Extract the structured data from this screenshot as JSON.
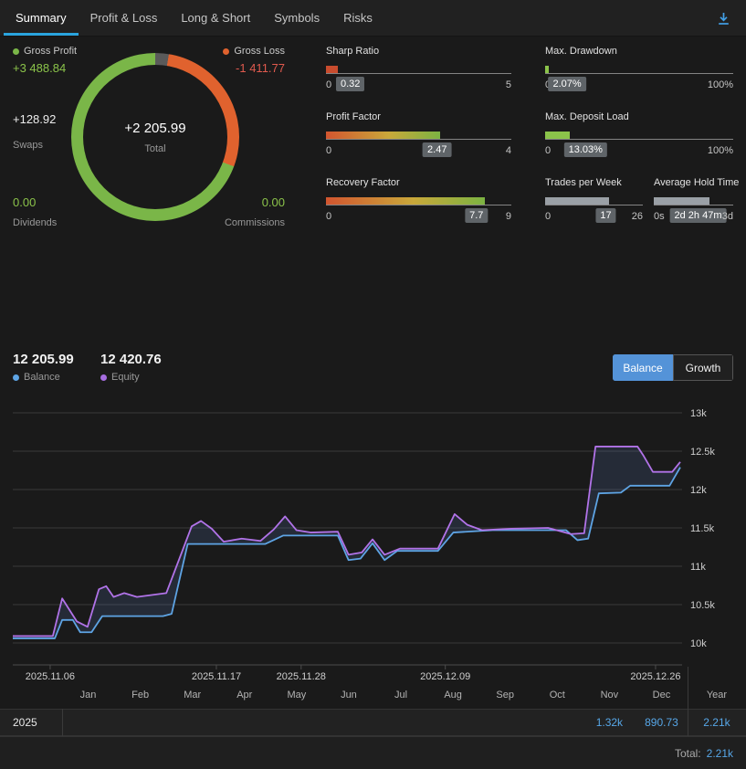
{
  "colors": {
    "accent_blue": "#2aa4de",
    "green": "#8bc34a",
    "orange": "#e0622e",
    "loss_red": "#e05a4e",
    "balance_line": "#5ea4e4",
    "equity_line": "#b173e8",
    "table_value_blue": "#57a7e8",
    "toggle_active": "#5493d8"
  },
  "tab_bar": {
    "tabs": [
      {
        "label": "Summary",
        "active": true
      },
      {
        "label": "Profit & Loss",
        "active": false
      },
      {
        "label": "Long & Short",
        "active": false
      },
      {
        "label": "Symbols",
        "active": false
      },
      {
        "label": "Risks",
        "active": false
      }
    ]
  },
  "summary": {
    "gross_profit": {
      "label": "Gross Profit",
      "value": "+3 488.84"
    },
    "gross_loss": {
      "label": "Gross Loss",
      "value": "-1 411.77"
    },
    "donut": {
      "center_value": "+2 205.99",
      "center_label": "Total",
      "segments": [
        {
          "name": "swaps",
          "color": "#5a5a5a",
          "pct": 2.6
        },
        {
          "name": "gross-loss",
          "color": "#e0622e",
          "pct": 28.1
        },
        {
          "name": "gross-profit",
          "color": "#7ab648",
          "pct": 69.3
        }
      ]
    },
    "swaps": {
      "value": "+128.92",
      "label": "Swaps"
    },
    "dividends": {
      "value": "0.00",
      "label": "Dividends"
    },
    "commissions": {
      "value": "0.00",
      "label": "Commissions"
    }
  },
  "gauges": [
    {
      "id": "sharp-ratio",
      "label": "Sharp Ratio",
      "min": "0",
      "max": "5",
      "value": "0.32",
      "fill_pct": 6.4,
      "style": "red"
    },
    {
      "id": "max-drawdown",
      "label": "Max. Drawdown",
      "min": "0",
      "max": "100%",
      "value": "2.07%",
      "fill_pct": 2.1,
      "style": "green"
    },
    {
      "id": "profit-factor",
      "label": "Profit Factor",
      "min": "0",
      "max": "4",
      "value": "2.47",
      "fill_pct": 61.8,
      "style": "gradient"
    },
    {
      "id": "max-deposit-load",
      "label": "Max. Deposit Load",
      "min": "0",
      "max": "100%",
      "value": "13.03%",
      "fill_pct": 13.0,
      "style": "green"
    },
    {
      "id": "recovery-factor",
      "label": "Recovery Factor",
      "min": "0",
      "max": "9",
      "value": "7.7",
      "fill_pct": 85.6,
      "style": "gradient"
    },
    {
      "id": "trades-per-week",
      "label": "Trades per Week",
      "min": "0",
      "max": "26",
      "value": "17",
      "fill_pct": 65.4,
      "style": "gray"
    },
    {
      "id": "average-hold-time",
      "label": "Average Hold Time",
      "min": "0s",
      "max": "3d",
      "value": "2d 2h 47m",
      "fill_pct": 70.0,
      "style": "gray"
    }
  ],
  "balance_header": {
    "balance_value": "12 205.99",
    "balance_label": "Balance",
    "equity_value": "12 420.76",
    "equity_label": "Equity",
    "toggle": [
      {
        "label": "Balance",
        "active": true
      },
      {
        "label": "Growth",
        "active": false
      }
    ]
  },
  "chart_data": {
    "type": "line",
    "ylim": [
      10000,
      13000
    ],
    "grid": true,
    "legend_position": "top-left",
    "y_ticks": [
      {
        "v": 13000,
        "label": "13k"
      },
      {
        "v": 12500,
        "label": "12.5k"
      },
      {
        "v": 12000,
        "label": "12k"
      },
      {
        "v": 11500,
        "label": "11.5k"
      },
      {
        "v": 11000,
        "label": "11k"
      },
      {
        "v": 10500,
        "label": "10.5k"
      },
      {
        "v": 10000,
        "label": "10k"
      }
    ],
    "x_ticks": [
      {
        "f": 0.056,
        "label": "2025.11.06"
      },
      {
        "f": 0.305,
        "label": "2025.11.17"
      },
      {
        "f": 0.432,
        "label": "2025.11.28"
      },
      {
        "f": 0.648,
        "label": "2025.12.09"
      },
      {
        "f": 0.963,
        "label": "2025.12.26"
      }
    ],
    "series": [
      {
        "name": "Balance",
        "color": "#5ea4e4",
        "points": [
          [
            0,
            10060
          ],
          [
            0.063,
            10060
          ],
          [
            0.074,
            10300
          ],
          [
            0.09,
            10300
          ],
          [
            0.101,
            10140
          ],
          [
            0.118,
            10140
          ],
          [
            0.134,
            10350
          ],
          [
            0.225,
            10350
          ],
          [
            0.238,
            10380
          ],
          [
            0.262,
            11290
          ],
          [
            0.378,
            11290
          ],
          [
            0.405,
            11400
          ],
          [
            0.487,
            11400
          ],
          [
            0.503,
            11080
          ],
          [
            0.521,
            11100
          ],
          [
            0.539,
            11300
          ],
          [
            0.557,
            11080
          ],
          [
            0.576,
            11200
          ],
          [
            0.637,
            11200
          ],
          [
            0.66,
            11440
          ],
          [
            0.719,
            11470
          ],
          [
            0.829,
            11470
          ],
          [
            0.846,
            11340
          ],
          [
            0.862,
            11360
          ],
          [
            0.878,
            11950
          ],
          [
            0.911,
            11960
          ],
          [
            0.925,
            12050
          ],
          [
            0.984,
            12050
          ],
          [
            1,
            12290
          ]
        ]
      },
      {
        "name": "Equity",
        "color": "#b173e8",
        "points": [
          [
            0,
            10090
          ],
          [
            0.06,
            10090
          ],
          [
            0.074,
            10580
          ],
          [
            0.085,
            10430
          ],
          [
            0.096,
            10280
          ],
          [
            0.112,
            10210
          ],
          [
            0.129,
            10700
          ],
          [
            0.14,
            10740
          ],
          [
            0.151,
            10600
          ],
          [
            0.167,
            10650
          ],
          [
            0.186,
            10600
          ],
          [
            0.23,
            10650
          ],
          [
            0.268,
            11520
          ],
          [
            0.282,
            11590
          ],
          [
            0.298,
            11490
          ],
          [
            0.316,
            11320
          ],
          [
            0.343,
            11360
          ],
          [
            0.371,
            11330
          ],
          [
            0.391,
            11480
          ],
          [
            0.408,
            11650
          ],
          [
            0.425,
            11470
          ],
          [
            0.446,
            11440
          ],
          [
            0.487,
            11450
          ],
          [
            0.503,
            11150
          ],
          [
            0.523,
            11180
          ],
          [
            0.539,
            11350
          ],
          [
            0.557,
            11150
          ],
          [
            0.58,
            11230
          ],
          [
            0.637,
            11230
          ],
          [
            0.662,
            11680
          ],
          [
            0.681,
            11540
          ],
          [
            0.703,
            11470
          ],
          [
            0.747,
            11490
          ],
          [
            0.802,
            11500
          ],
          [
            0.836,
            11420
          ],
          [
            0.856,
            11430
          ],
          [
            0.873,
            12560
          ],
          [
            0.936,
            12560
          ],
          [
            0.945,
            12440
          ],
          [
            0.959,
            12230
          ],
          [
            0.988,
            12230
          ],
          [
            1,
            12360
          ]
        ]
      }
    ]
  },
  "monthly_table": {
    "months": [
      "Jan",
      "Feb",
      "Mar",
      "Apr",
      "May",
      "Jun",
      "Jul",
      "Aug",
      "Sep",
      "Oct",
      "Nov",
      "Dec"
    ],
    "year_column": "Year",
    "rows": [
      {
        "label": "2025",
        "values": [
          "",
          "",
          "",
          "",
          "",
          "",
          "",
          "",
          "",
          "",
          "1.32k",
          "890.73"
        ],
        "year_total": "2.21k"
      }
    ],
    "footer": {
      "label": "Total:",
      "value": "2.21k"
    }
  }
}
